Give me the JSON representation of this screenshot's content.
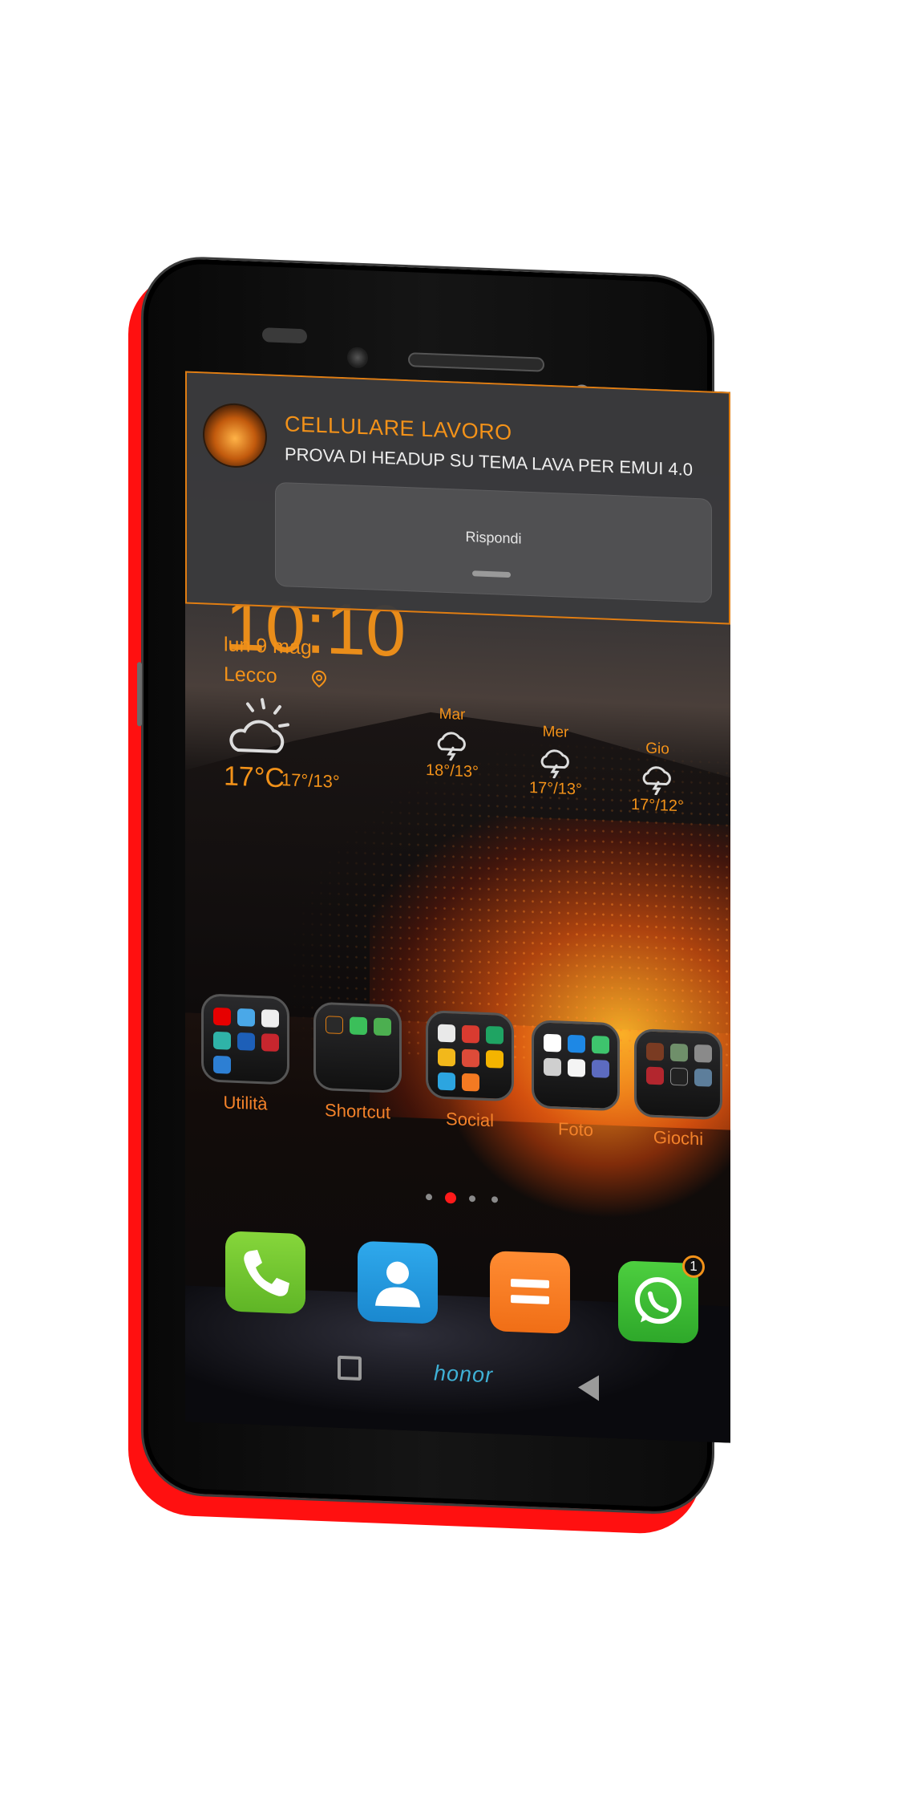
{
  "notification": {
    "title": "CELLULARE LAVORO",
    "message": "PROVA DI HEADUP SU TEMA LAVA PER EMUI 4.0",
    "action_label": "Rispondi"
  },
  "clock": {
    "partial": "10:10"
  },
  "date": "lun 9 mag",
  "location": "Lecco",
  "weather": {
    "current_temp": "17°C",
    "current_range": "17°/13°",
    "forecast": [
      {
        "day": "Mar",
        "temp": "18°/13°",
        "icon": "thunderstorm-icon"
      },
      {
        "day": "Mer",
        "temp": "17°/13°",
        "icon": "thunderstorm-icon"
      },
      {
        "day": "Gio",
        "temp": "17°/12°",
        "icon": "thunderstorm-icon"
      }
    ]
  },
  "folders": [
    {
      "label": "Utilità"
    },
    {
      "label": "Shortcut"
    },
    {
      "label": "Social"
    },
    {
      "label": "Foto"
    },
    {
      "label": "Giochi"
    }
  ],
  "page_indicator": {
    "count": 4,
    "active": 2
  },
  "dock": [
    {
      "app": "phone-icon",
      "color": "#6bc52f"
    },
    {
      "app": "contacts-icon",
      "color": "#1e9be0"
    },
    {
      "app": "messages-icon",
      "color": "#f47a22"
    },
    {
      "app": "whatsapp-icon",
      "color": "#3fbf35",
      "badge": "1"
    }
  ],
  "nav": {
    "brand": "honor"
  },
  "colors": {
    "accent": "#f39219",
    "notification_border": "#e07d12",
    "frame_edge": "#ff1010"
  }
}
